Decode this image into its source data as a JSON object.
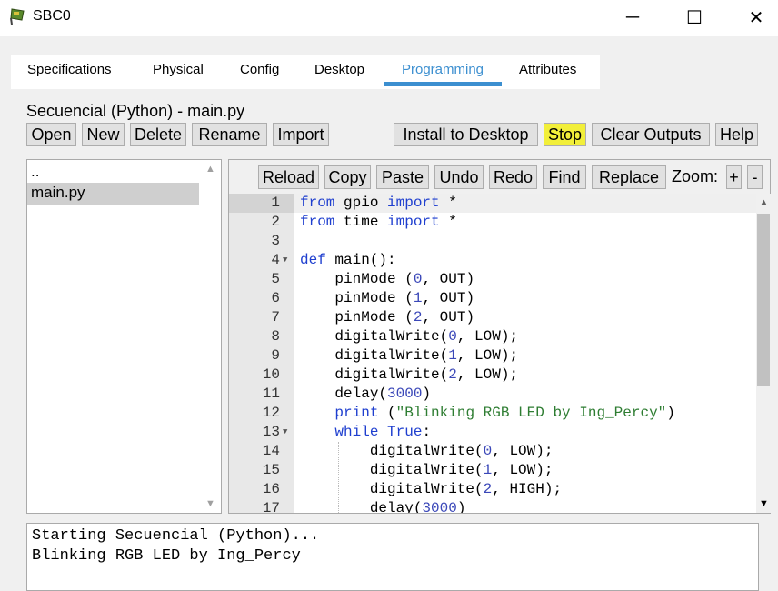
{
  "window": {
    "title": "SBC0",
    "minimize_glyph": "─",
    "maximize_glyph": "☐",
    "close_glyph": "✕",
    "icon": "sbc-device-icon"
  },
  "tabs": [
    {
      "label": "Specifications"
    },
    {
      "label": "Physical"
    },
    {
      "label": "Config"
    },
    {
      "label": "Desktop"
    },
    {
      "label": "Programming",
      "active": true
    },
    {
      "label": "Attributes"
    }
  ],
  "file_title": "Secuencial (Python) - main.py",
  "project_buttons": {
    "open": "Open",
    "new": "New",
    "delete": "Delete",
    "rename": "Rename",
    "import": "Import",
    "install": "Install to Desktop",
    "stop": "Stop",
    "clear_outputs": "Clear Outputs",
    "help": "Help"
  },
  "file_list": {
    "items": [
      {
        "name": ".."
      },
      {
        "name": "main.py",
        "selected": true
      }
    ]
  },
  "editor_toolbar": {
    "reload": "Reload",
    "copy": "Copy",
    "paste": "Paste",
    "undo": "Undo",
    "redo": "Redo",
    "find": "Find",
    "replace": "Replace",
    "zoom_label": "Zoom:",
    "zoom_in": "+",
    "zoom_out": "-"
  },
  "code": {
    "lines": [
      {
        "n": "1",
        "text": "from gpio import *"
      },
      {
        "n": "2",
        "text": "from time import *"
      },
      {
        "n": "3",
        "text": ""
      },
      {
        "n": "4",
        "text": "def main():",
        "fold": true
      },
      {
        "n": "5",
        "text": "    pinMode (0, OUT)"
      },
      {
        "n": "6",
        "text": "    pinMode (1, OUT)"
      },
      {
        "n": "7",
        "text": "    pinMode (2, OUT)"
      },
      {
        "n": "8",
        "text": "    digitalWrite(0, LOW);"
      },
      {
        "n": "9",
        "text": "    digitalWrite(1, LOW);"
      },
      {
        "n": "10",
        "text": "    digitalWrite(2, LOW);"
      },
      {
        "n": "11",
        "text": "    delay(3000)"
      },
      {
        "n": "12",
        "text": "    print (\"Blinking RGB LED by Ing_Percy\")"
      },
      {
        "n": "13",
        "text": "    while True:",
        "fold": true
      },
      {
        "n": "14",
        "text": "        digitalWrite(0, LOW);"
      },
      {
        "n": "15",
        "text": "        digitalWrite(1, LOW);"
      },
      {
        "n": "16",
        "text": "        digitalWrite(2, HIGH);"
      },
      {
        "n": "17",
        "text": "        delay(3000)"
      }
    ],
    "colors": {
      "keyword": "#1f3fcf",
      "number": "#3a47b8",
      "string": "#2e7d32"
    }
  },
  "output": {
    "lines": [
      "Starting Secuencial (Python)...",
      "Blinking RGB LED by Ing_Percy"
    ]
  },
  "colors": {
    "accent": "#3c8fd0",
    "stop_highlight": "#f2ef3a",
    "window_bg": "#f0f0f0"
  }
}
